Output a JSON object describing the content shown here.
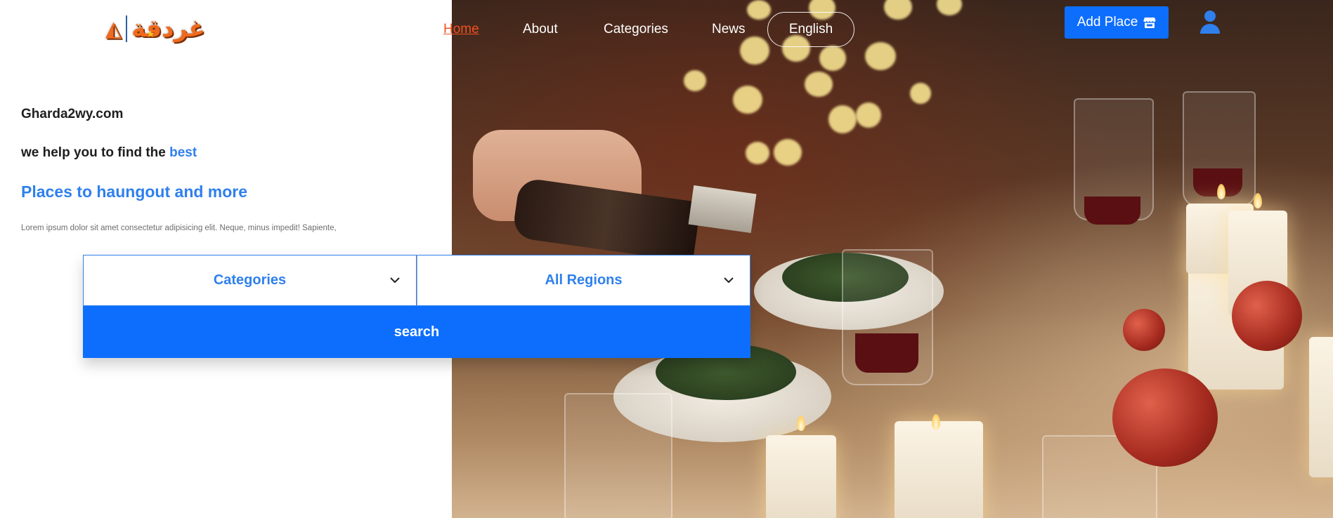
{
  "logo": {
    "text": "غردقة"
  },
  "nav": {
    "items": [
      {
        "label": "Home",
        "active": true
      },
      {
        "label": "About",
        "active": false
      },
      {
        "label": "Categories",
        "active": false
      },
      {
        "label": "News",
        "active": false
      }
    ],
    "language": "English",
    "add_place_label": "Add Place",
    "add_place_icon": "store-icon",
    "user_icon": "user-icon"
  },
  "hero": {
    "site_name": "Gharda2wy.com",
    "tagline_prefix": "we help you to find the",
    "tagline_accent": "best",
    "headline": "Places to haungout and more",
    "description": "Lorem ipsum dolor sit amet consectetur adipisicing elit. Neque, minus impedit! Sapiente,"
  },
  "search": {
    "category_select": "Categories",
    "region_select": "All Regions",
    "button_label": "search"
  },
  "colors": {
    "accent_blue": "#2f80ed",
    "button_blue": "#0d6efd",
    "active_link": "#f0511f",
    "logo_orange": "#ef6a1e"
  }
}
